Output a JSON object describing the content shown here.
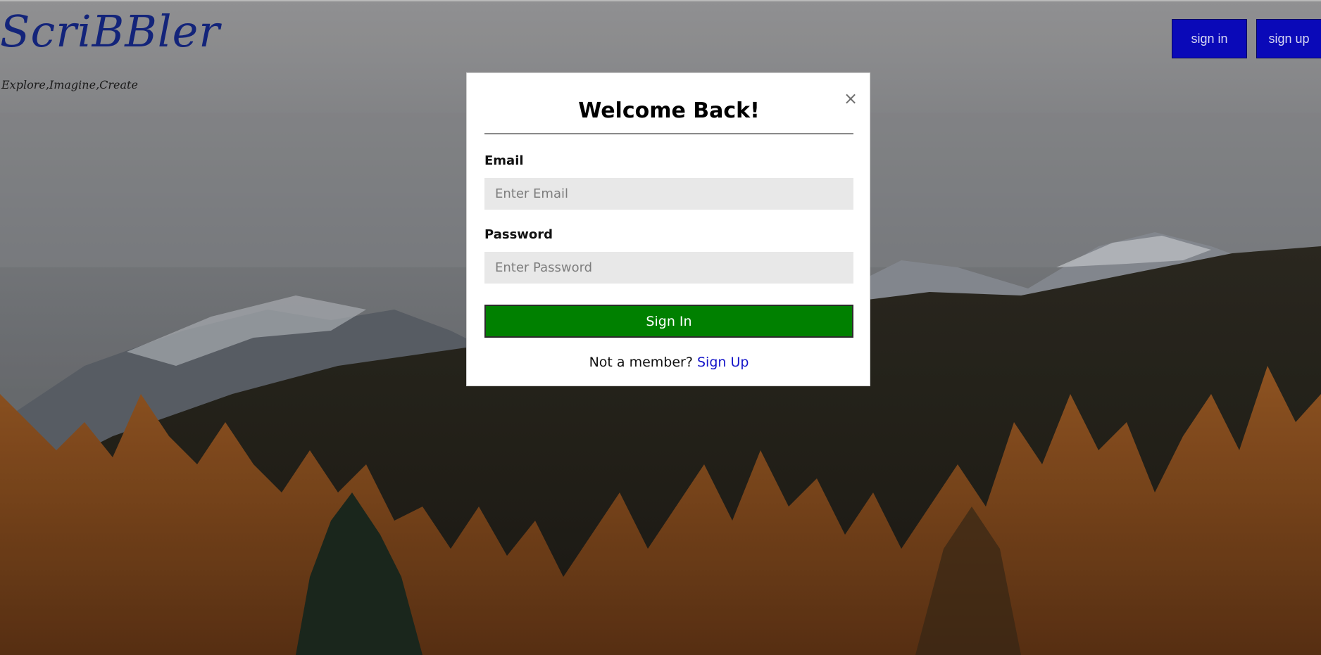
{
  "brand": {
    "logo_text": "ScriBBler",
    "tagline": "Explore,Imagine,Create"
  },
  "header": {
    "signin_label": "sign in",
    "signup_label": "sign up"
  },
  "modal": {
    "close_glyph": "×",
    "title": "Welcome Back!",
    "email_label": "Email",
    "email_placeholder": "Enter Email",
    "password_label": "Password",
    "password_placeholder": "Enter Password",
    "submit_label": "Sign In",
    "footer_text": "Not a member?",
    "footer_link": "Sign Up"
  },
  "colors": {
    "header_button": "#0a09b8",
    "submit_button": "#008000",
    "link": "#1515c9",
    "logo": "#13247a"
  },
  "background_icon": "mountain-forest-landscape"
}
